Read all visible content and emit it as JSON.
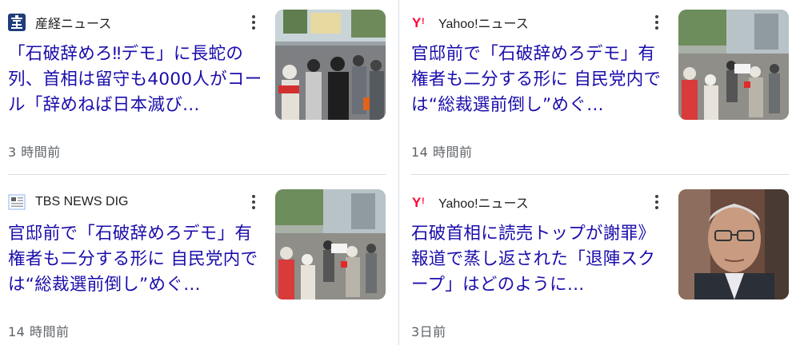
{
  "cards": [
    {
      "source": "産経ニュース",
      "favicon": "sankei-logo-icon",
      "headline": "「石破辞めろ‼デモ」に長蛇の列、首相は留守も4000人がコール「辞めねば日本滅び…",
      "time": "3 時間前",
      "thumbnail": "protest-crowd-photo"
    },
    {
      "source": "Yahoo!ニュース",
      "favicon": "yahoo-logo-icon",
      "headline": "官邸前で「石破辞めろデモ」有権者も二分する形に 自民党内では“総裁選前倒し”めぐ…",
      "time": "14 時間前",
      "thumbnail": "protest-street-photo"
    },
    {
      "source": "TBS NEWS DIG",
      "favicon": "tbs-logo-icon",
      "headline": "官邸前で「石破辞めろデモ」有権者も二分する形に 自民党内では“総裁選前倒し”めぐ…",
      "time": "14 時間前",
      "thumbnail": "protest-street-photo"
    },
    {
      "source": "Yahoo!ニュース",
      "favicon": "yahoo-logo-icon",
      "headline": "石破首相に読売トップが謝罪》報道で蒸し返された「退陣スクープ」はどのように…",
      "time": "3日前",
      "thumbnail": "politician-portrait-photo"
    }
  ],
  "colors": {
    "headline": "#1a0dab",
    "meta": "#5f6368",
    "divider": "#dadce0",
    "yahoo_red": "#ff0033"
  }
}
